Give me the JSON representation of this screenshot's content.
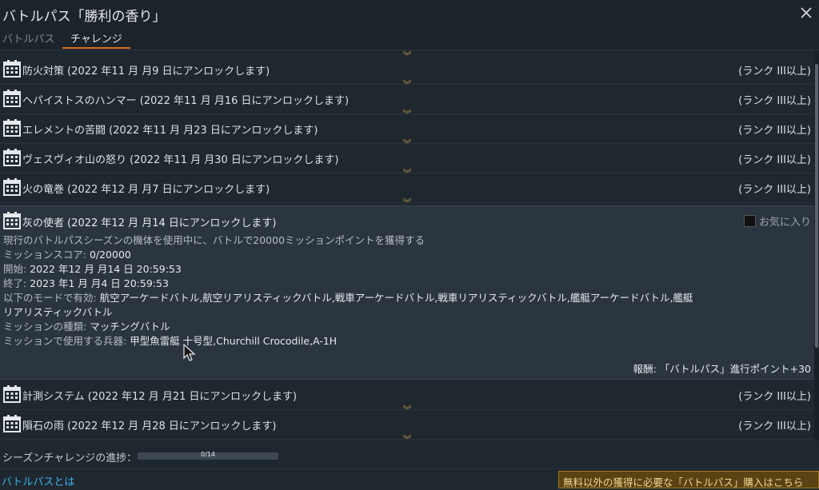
{
  "window": {
    "title": "バトルパス「勝利の香り」"
  },
  "tabs": [
    {
      "label": "バトルパス",
      "active": false
    },
    {
      "label": "チャレンジ",
      "active": true
    }
  ],
  "challenges": [
    {
      "title": "防火対策 (2022 年11 月 月9 日にアンロックします)",
      "rank": "(ランク III以上)"
    },
    {
      "title": "ヘパイストスのハンマー (2022 年11 月 月16 日にアンロックします)",
      "rank": "(ランク III以上)"
    },
    {
      "title": "エレメントの苦闘 (2022 年11 月 月23 日にアンロックします)",
      "rank": "(ランク III以上)"
    },
    {
      "title": "ヴェスヴィオ山の怒り (2022 年11 月 月30 日にアンロックします)",
      "rank": "(ランク III以上)"
    },
    {
      "title": "火の竜巻 (2022 年12 月 月7 日にアンロックします)",
      "rank": "(ランク III以上)"
    }
  ],
  "expanded": {
    "title": "灰の使者 (2022 年12 月 月14 日にアンロックします)",
    "favorite_label": "お気に入り",
    "description": "現行のバトルパスシーズンの機体を使用中に、バトルで20000ミッションポイントを獲得する",
    "score_label": "ミッションスコア: ",
    "score_value": "0/20000",
    "start_label": "開始: ",
    "start_value": "2022 年12 月 月14 日 20:59:53",
    "end_label": "終了: ",
    "end_value": "2023 年1 月 月4 日 20:59:53",
    "modes_label": "以下のモードで有効: ",
    "modes_line1": "航空アーケードバトル,航空リアリスティックバトル,戦車アーケードバトル,戦車リアリスティックバトル,艦艇アーケードバトル,艦艇",
    "modes_line2": "リアリスティックバトル",
    "type_label": "ミッションの種類: ",
    "type_value": "マッチングバトル",
    "weapons_label": "ミッションで使用する兵器: ",
    "weapons_value": "甲型魚雷艇 十号型,Churchill Crocodile,A-1H",
    "reward": "報酬: 「バトルパス」進行ポイント+30"
  },
  "challenges_after": [
    {
      "title": "計測システム (2022 年12 月 月21 日にアンロックします)",
      "rank": "(ランク III以上)"
    },
    {
      "title": "隕石の雨 (2022 年12 月 月28 日にアンロックします)",
      "rank": "(ランク III以上)"
    }
  ],
  "season_progress": {
    "label": "シーズンチャレンジの進捗：",
    "text": "0/14",
    "fraction": 0.0
  },
  "footer": {
    "link": "バトルパスとは",
    "buy_button": "無料以外の獲得に必要な「バトルパス」購入はこちら"
  },
  "colors": {
    "accent": "#d9701f",
    "link": "#38b3ea",
    "buy_bg": "#5a4212",
    "buy_text": "#f0d594"
  }
}
